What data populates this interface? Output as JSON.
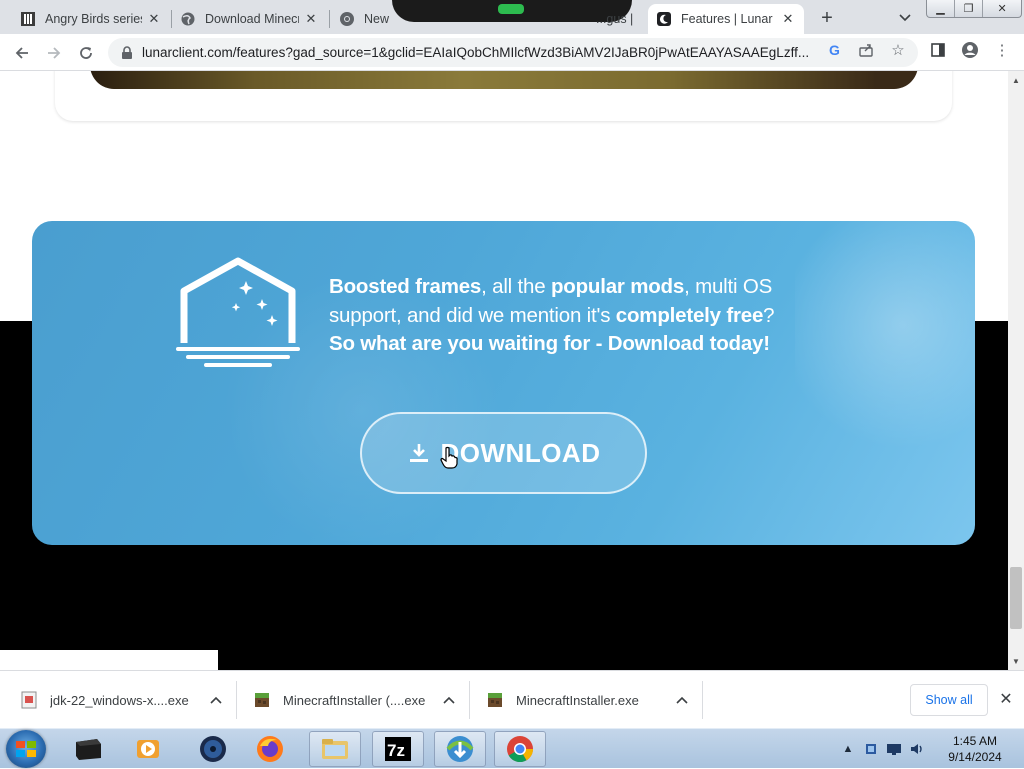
{
  "browser": {
    "tabs": [
      {
        "title": "Angry Birds series",
        "favicon": "angry-birds-favicon"
      },
      {
        "title": "Download Minecraft",
        "favicon": "globe-icon"
      },
      {
        "title": "New Tab",
        "favicon": "chrome-icon"
      },
      {
        "title": "...gus |",
        "favicon": "none"
      },
      {
        "title": "Features | Lunar Client",
        "favicon": "lunar-favicon",
        "active": true
      }
    ],
    "url": "lunarclient.com/features?gad_source=1&gclid=EAIaIQobChMIlcfWzd3BiAMV2IJaBR0jPwAtEAAYASAAEgLzff..."
  },
  "promo": {
    "line1_part1_bold": "Boosted frames",
    "line1_part2": ", all the ",
    "line1_part3_bold": "popular mods",
    "line1_part4": ", multi OS",
    "line2_part1": "support, and did we mention it's ",
    "line2_part2_bold": "completely free",
    "line2_part3": "?",
    "line3_bold": "So what are you waiting for - Download today!",
    "download_label": "DOWNLOAD"
  },
  "downloads": {
    "items": [
      {
        "name": "jdk-22_windows-x....exe",
        "icon": "installer-file-icon"
      },
      {
        "name": "MinecraftInstaller (....exe",
        "icon": "minecraft-file-icon"
      },
      {
        "name": "MinecraftInstaller.exe",
        "icon": "minecraft-file-icon"
      }
    ],
    "show_all": "Show all"
  },
  "taskbar": {
    "time": "1:45 AM",
    "date": "9/14/2024",
    "apps": [
      "media-player",
      "disc-burner",
      "firefox",
      "file-explorer",
      "7zip",
      "idm",
      "chrome"
    ]
  },
  "colors": {
    "promo_blue": "#4fa7d8",
    "show_all_blue": "#1a73e8"
  }
}
